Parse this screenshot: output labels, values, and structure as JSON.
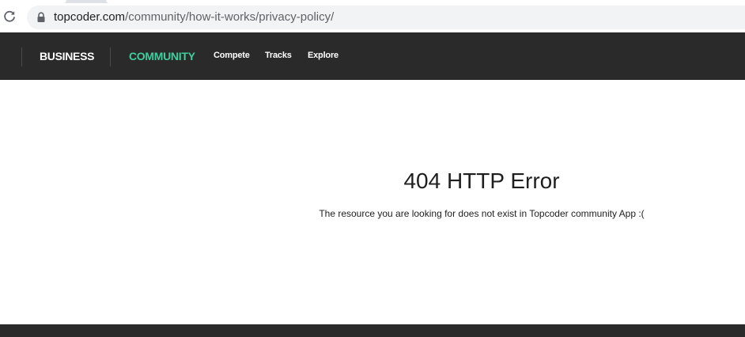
{
  "browser": {
    "url_host": "topcoder.com",
    "url_path": "/community/how-it-works/privacy-policy/",
    "reload_icon": "reload-icon",
    "lock_icon": "lock-icon"
  },
  "navbar": {
    "main_items": [
      {
        "label": "BUSINESS",
        "active": false
      },
      {
        "label": "COMMUNITY",
        "active": true
      }
    ],
    "sub_items": [
      {
        "label": "Compete"
      },
      {
        "label": "Tracks"
      },
      {
        "label": "Explore"
      }
    ],
    "colors": {
      "background": "#2a2a2a",
      "active": "#3ecf9e",
      "text": "#ffffff"
    }
  },
  "main": {
    "title": "404 HTTP Error",
    "message": "The resource you are looking for does not exist in Topcoder community App :("
  }
}
